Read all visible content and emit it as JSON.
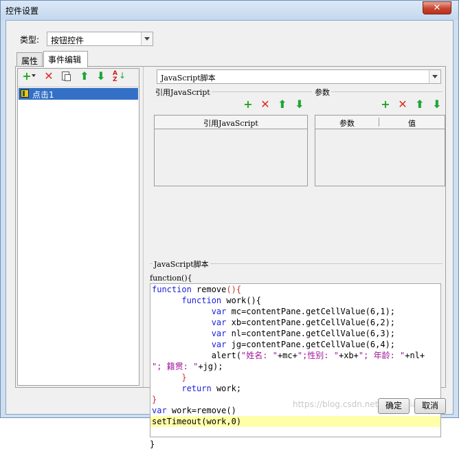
{
  "window": {
    "title": "控件设置",
    "close_label": "✕"
  },
  "type_field": {
    "label": "类型:",
    "value": "按钮控件"
  },
  "tabs": [
    {
      "label": "属性",
      "active": false
    },
    {
      "label": "事件编辑",
      "active": true
    }
  ],
  "left_toolbar": {
    "buttons": [
      "add-dropdown",
      "delete",
      "copy",
      "move-up",
      "move-down",
      "sort"
    ]
  },
  "event_list": {
    "items": [
      {
        "label": "点击1",
        "selected": true
      }
    ]
  },
  "script_type": {
    "value": "JavaScript脚本"
  },
  "sections": {
    "ref_js": "引用JavaScript",
    "params": "参数",
    "script": "JavaScript脚本"
  },
  "ref_table": {
    "columns": [
      "引用JavaScript"
    ]
  },
  "param_table": {
    "columns": [
      "参数",
      "值"
    ]
  },
  "code": {
    "header": "function(){",
    "footer": "}",
    "lines": [
      "function remove(){",
      "      function work(){",
      "            var mc=contentPane.getCellValue(6,1);",
      "            var xb=contentPane.getCellValue(6,2);",
      "            var nl=contentPane.getCellValue(6,3);",
      "            var jg=contentPane.getCellValue(6,4);",
      "            alert(\"姓名: \"+mc+\";性别: \"+xb+\"; 年龄: \"+nl+",
      "\"; 籍贯: \"+jg);",
      "      }",
      "      return work;",
      "}",
      "var work=remove()",
      "setTimeout(work,0)"
    ],
    "highlight_line": 12
  },
  "buttons": {
    "ok": "确定",
    "cancel": "取消"
  },
  "watermark": "https://blog.csdn.net/ChengJiaJun",
  "colors": {
    "selection": "#3370c6",
    "keyword": "#1c22d8",
    "string": "#a1169a",
    "highlight": "#ffffaa",
    "add": "#23a323",
    "delete": "#e02b1e"
  }
}
